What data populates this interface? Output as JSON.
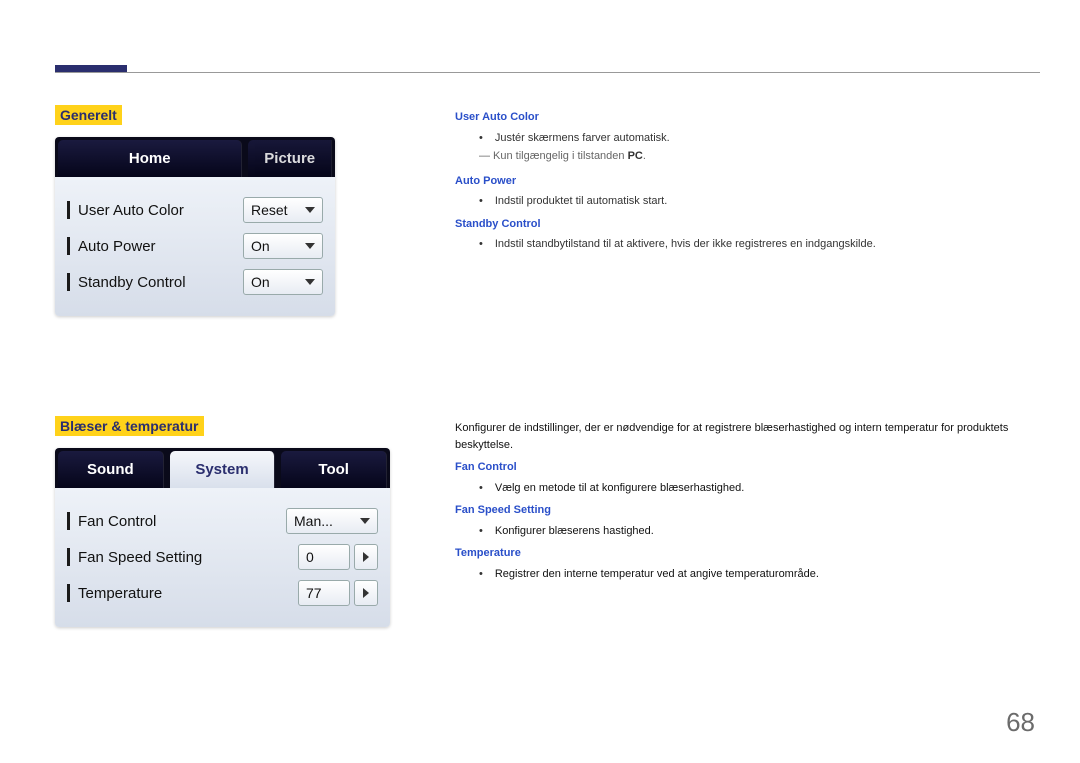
{
  "page_number": "68",
  "section1": {
    "heading": "Generelt",
    "tabs": [
      "Home",
      "Picture"
    ],
    "rows": [
      {
        "label": "User Auto Color",
        "value": "Reset"
      },
      {
        "label": "Auto Power",
        "value": "On"
      },
      {
        "label": "Standby Control",
        "value": "On"
      }
    ]
  },
  "desc1": {
    "h1": "User Auto Color",
    "b1": "Justér skærmens farver automatisk.",
    "note_prefix": "― Kun tilgængelig i tilstanden ",
    "note_bold": "PC",
    "note_suffix": ".",
    "h2": "Auto Power",
    "b2": "Indstil produktet til automatisk start.",
    "h3": "Standby Control",
    "b3": "Indstil standbytilstand til at aktivere, hvis der ikke registreres en indgangskilde."
  },
  "section2": {
    "heading": "Blæser & temperatur",
    "tabs": [
      "Sound",
      "System",
      "Tool"
    ],
    "active_tab_index": 1,
    "rows": [
      {
        "label": "Fan Control",
        "type": "dropdown",
        "value": "Man..."
      },
      {
        "label": "Fan Speed Setting",
        "type": "spinner",
        "value": "0"
      },
      {
        "label": "Temperature",
        "type": "spinner",
        "value": "77"
      }
    ]
  },
  "desc2": {
    "intro": "Konfigurer de indstillinger, der er nødvendige for at registrere blæserhastighed og intern temperatur for produktets beskyttelse.",
    "h1": "Fan Control",
    "b1": "Vælg en metode til at konfigurere blæserhastighed.",
    "h2": "Fan Speed Setting",
    "b2": "Konfigurer blæserens hastighed.",
    "h3": "Temperature",
    "b3": "Registrer den interne temperatur ved at angive temperaturområde."
  }
}
